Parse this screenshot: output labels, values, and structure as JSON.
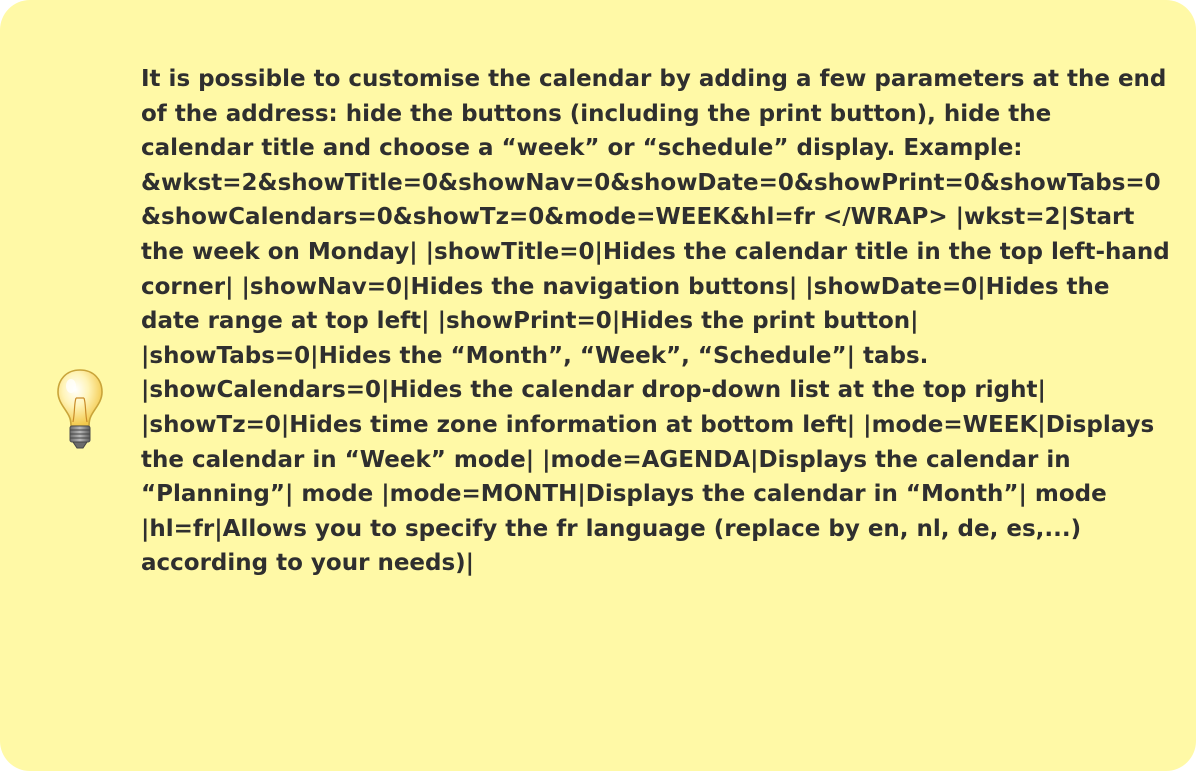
{
  "tip": {
    "icon": "lightbulb-icon",
    "background_color": "#fff9a6",
    "text": "It is possible to customise the calendar by adding a few parameters at the end of the address: hide the buttons (including the print button), hide the calendar title and choose a “week” or “schedule” display. Example: &wkst=2&showTitle=0&showNav=0&showDate=0&showPrint=0&showTabs=0&showCalendars=0&showTz=0&mode=WEEK&hl=fr </WRAP> |wkst=2|Start the week on Monday| |showTitle=0|Hides the calendar title in the top left-hand corner| |showNav=0|Hides the navigation buttons| |showDate=0|Hides the date range at top left| |showPrint=0|Hides the print button| |showTabs=0|Hides the “Month”, “Week”, “Schedule”| tabs. |showCalendars=0|Hides the calendar drop-down list at the top right| |showTz=0|Hides time zone information at bottom left| |mode=WEEK|Displays the calendar in “Week” mode| |mode=AGENDA|Displays the calendar in “Planning”| mode |mode=MONTH|Displays the calendar in “Month”| mode |hl=fr|Allows you to specify the fr language (replace by en, nl, de, es,...) according to your needs)|"
  }
}
